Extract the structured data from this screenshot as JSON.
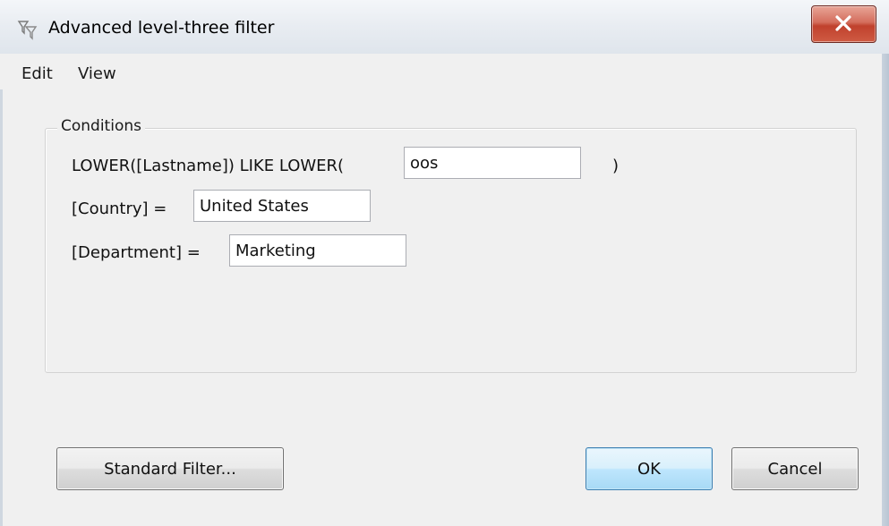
{
  "window": {
    "title": "Advanced level-three filter",
    "app_icon": "filter-funnel-icon",
    "close_icon": "close-x-icon",
    "accent_close": "#c8432f"
  },
  "menu": {
    "items": [
      "Edit",
      "View"
    ]
  },
  "conditions": {
    "group_label": "Conditions",
    "rows": [
      {
        "prefix": "LOWER([Lastname]) LIKE LOWER(",
        "value": "oos",
        "suffix": ")"
      },
      {
        "prefix": "[Country] =",
        "value": "United States"
      },
      {
        "prefix": "[Department] =",
        "value": "Marketing"
      }
    ]
  },
  "buttons": {
    "standard_filter": "Standard Filter...",
    "ok": "OK",
    "cancel": "Cancel"
  }
}
